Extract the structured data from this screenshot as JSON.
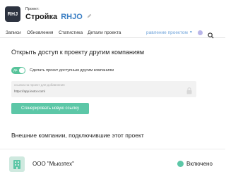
{
  "project": {
    "avatar_text": "RHJ",
    "caption": "Проект:",
    "name": "Стройка",
    "code": "RHJO",
    "edit_icon": "pencil-icon"
  },
  "tabs": [
    {
      "label": "Записи"
    },
    {
      "label": "Обновления"
    },
    {
      "label": "Статистика"
    },
    {
      "label": "Детали проекта"
    }
  ],
  "tab_dropdown": {
    "label": "равление проектом"
  },
  "header_icons": {
    "status_dot_color": "#b9b6e8",
    "search": "search-icon"
  },
  "share": {
    "title": "Открыть доступ к проекту другим компаниям",
    "toggle_state": "Да",
    "toggle_label": "Сделать проект доступным другим компаниям",
    "link_label": "ссылка на проект для добавления",
    "link_value": "https://app.lextor.com/",
    "lock_icon": "lock-icon",
    "generate_button": "Сгенерировать новую ссылку"
  },
  "companies": {
    "title": "Внешние компании, подключившие этот проект",
    "items": [
      {
        "name": "ООО \"Мьюзтех\"",
        "status": "Включено",
        "status_color": "#5cc7a7"
      }
    ]
  },
  "colors": {
    "accent": "#5cc7a7",
    "link_blue": "#3b7fc4",
    "dark": "#2d3340"
  }
}
